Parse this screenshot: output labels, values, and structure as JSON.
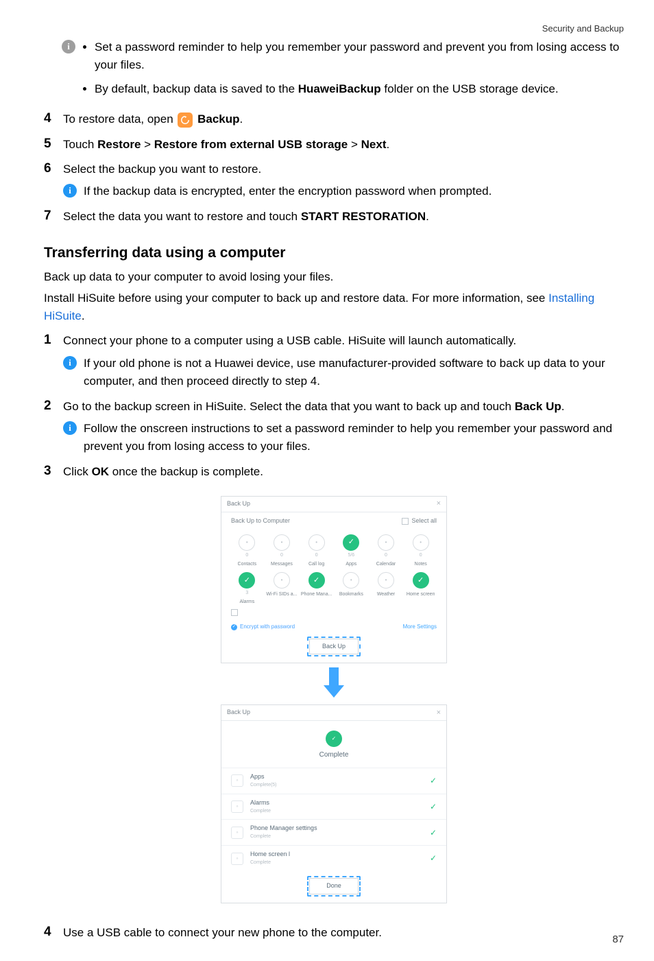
{
  "page": {
    "running_header": "Security and Backup",
    "number": "87"
  },
  "top_info": {
    "bullets": [
      "Set a password reminder to help you remember your password and prevent you from losing access to your files.",
      {
        "prefix": "By default, backup data is saved to the ",
        "bold": "HuaweiBackup",
        "suffix": " folder on the USB storage device."
      }
    ]
  },
  "steps_a": {
    "s4": {
      "num": "4",
      "prefix": "To restore data, open ",
      "app": "Backup",
      "suffix": "."
    },
    "s5": {
      "num": "5",
      "t1": "Touch ",
      "b1": "Restore",
      "sep1": " > ",
      "b2": "Restore from external USB storage",
      "sep2": " > ",
      "b3": "Next",
      "tail": "."
    },
    "s6": {
      "num": "6",
      "text": "Select the backup you want to restore.",
      "info": "If the backup data is encrypted, enter the encryption password when prompted."
    },
    "s7": {
      "num": "7",
      "t1": "Select the data you want to restore and touch ",
      "b1": "START RESTORATION",
      "tail": "."
    }
  },
  "section": {
    "title": "Transferring data using a computer",
    "p1": "Back up data to your computer to avoid losing your files.",
    "p2_a": "Install HiSuite before using your computer to back up and restore data. For more information, see ",
    "p2_link": "Installing HiSuite",
    "p2_b": "."
  },
  "steps_b": {
    "s1": {
      "num": "1",
      "text": "Connect your phone to a computer using a USB cable. HiSuite will launch automatically.",
      "info": "If your old phone is not a Huawei device, use manufacturer-provided software to back up data to your computer, and then proceed directly to step 4."
    },
    "s2": {
      "num": "2",
      "t1": "Go to the backup screen in HiSuite. Select the data that you want to back up and touch ",
      "b1": "Back Up",
      "tail": ".",
      "info": "Follow the onscreen instructions to set a password reminder to help you remember your password and prevent you from losing access to your files."
    },
    "s3": {
      "num": "3",
      "t1": "Click ",
      "b1": "OK",
      "tail": " once the backup is complete."
    },
    "s4": {
      "num": "4",
      "text": "Use a USB cable to connect your new phone to the computer."
    }
  },
  "hisuite": {
    "win1": {
      "title": "Back Up",
      "subtitle": "Back Up to Computer",
      "select_all": "Select all",
      "grid": [
        {
          "count": "0",
          "label": "Contacts",
          "selected": false
        },
        {
          "count": "0",
          "label": "Messages",
          "selected": false
        },
        {
          "count": "0",
          "label": "Call log",
          "selected": false
        },
        {
          "count": "5/6",
          "label": "Apps",
          "selected": true
        },
        {
          "count": "0",
          "label": "Calendar",
          "selected": false
        },
        {
          "count": "0",
          "label": "Notes",
          "selected": false
        },
        {
          "count": "3",
          "label": "Alarms",
          "selected": true
        },
        {
          "count": "",
          "label": "Wi-Fi SIDs a...",
          "selected": false
        },
        {
          "count": "",
          "label": "Phone Mana...",
          "selected": true
        },
        {
          "count": "",
          "label": "Bookmarks",
          "selected": false
        },
        {
          "count": "",
          "label": "Weather",
          "selected": false
        },
        {
          "count": "",
          "label": "Home screen",
          "selected": true
        }
      ],
      "encrypt_label": "Encrypt with password",
      "more_settings": "More Settings",
      "backup_btn": "Back Up"
    },
    "win2": {
      "title": "Back Up",
      "complete": "Complete",
      "rows": [
        {
          "title": "Apps",
          "sub": "Complete(5)"
        },
        {
          "title": "Alarms",
          "sub": "Complete"
        },
        {
          "title": "Phone Manager settings",
          "sub": "Complete"
        },
        {
          "title": "Home screen l",
          "sub": "Complete"
        }
      ],
      "done_btn": "Done"
    }
  }
}
